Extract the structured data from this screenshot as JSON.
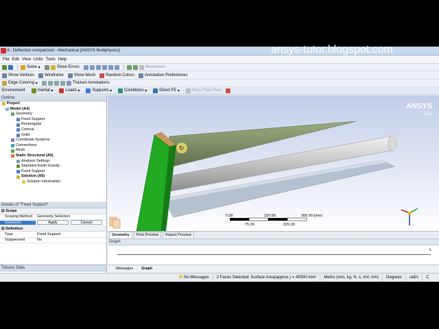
{
  "window": {
    "title": "A : Deflection comparision - Mechanical [ANSYS Multiphysics]"
  },
  "watermark": "ansys-tutor.blogspot.com",
  "menu": [
    "File",
    "Edit",
    "View",
    "Units",
    "Tools",
    "Help"
  ],
  "toolbar1": {
    "solve": "Solve",
    "show_errors": "Show Errors",
    "worksheet": "Worksheet"
  },
  "toolbar2": {
    "show_vertices": "Show Vertices",
    "wireframe": "Wireframe",
    "show_mesh": "Show Mesh",
    "random_colors": "Random Colors",
    "annotation_preferences": "Annotation Preferences"
  },
  "toolbar3": {
    "edge_coloring": "Edge Coloring",
    "thicken_annotations": "Thicken Annotations"
  },
  "context_toolbar": {
    "environment": "Environment",
    "inertial": "Inertial",
    "loads": "Loads",
    "supports": "Supports",
    "conditions": "Conditions",
    "direct_fe": "Direct FE",
    "mass_flow_rate": "Mass Flow Rate"
  },
  "outline": {
    "header": "Outline",
    "nodes": [
      {
        "label": "Project",
        "bold": true
      },
      {
        "label": "Model (A4)",
        "bold": true
      },
      {
        "label": "Geometry",
        "bold": false
      },
      {
        "label": "Fixed Support",
        "bold": false
      },
      {
        "label": "Rectangular",
        "bold": false
      },
      {
        "label": "Conical",
        "bold": false
      },
      {
        "label": "Solid",
        "bold": false
      },
      {
        "label": "Coordinate Systems",
        "bold": false
      },
      {
        "label": "Connections",
        "bold": false
      },
      {
        "label": "Mesh",
        "bold": false
      },
      {
        "label": "Static Structural (A5)",
        "bold": true
      },
      {
        "label": "Analysis Settings",
        "bold": false
      },
      {
        "label": "Standard Earth Gravity",
        "bold": false
      },
      {
        "label": "Fixed Support",
        "bold": false
      },
      {
        "label": "Solution (A6)",
        "bold": true
      },
      {
        "label": "Solution Information",
        "bold": false
      }
    ]
  },
  "details": {
    "header": "Details of \"Fixed Support\"",
    "scope_section": "Scope",
    "scoping_method_label": "Scoping Method",
    "scoping_method_value": "Geometry Selection",
    "geometry_label": "Geometry",
    "apply_label": "Apply",
    "cancel_label": "Cancel",
    "definition_section": "Definition",
    "type_label": "Type",
    "type_value": "Fixed Support",
    "suppressed_label": "Suppressed",
    "suppressed_value": "No"
  },
  "tabular": {
    "header": "Tabular Data"
  },
  "viewport": {
    "brand": "ANSYS",
    "version": "16.0",
    "scale_labels": [
      "0.00",
      "150.00",
      "300.00 (mm)",
      "75.00",
      "225.00"
    ]
  },
  "view_tabs": [
    "Geometry",
    "Print Preview",
    "Report Preview"
  ],
  "graph": {
    "header": "Graph",
    "marker": "1."
  },
  "bottom_tabs": [
    "Messages",
    "Graph"
  ],
  "status": {
    "messages": "No Messages",
    "selection": "2 Faces Selected: Surface Area(approx.) = 45500 mm²",
    "units": "Metric (mm, kg, N, s, mV, mA)",
    "angle": "Degrees",
    "rate": "rad/s",
    "temp": "C"
  },
  "colors": {
    "titlebar": "#c8d8ec",
    "selection": "#3a78c9",
    "support_face": "#22aa22",
    "cone": "#7f8f68",
    "cylinder": "#c0c0c0",
    "block": "#b9c3d0"
  }
}
